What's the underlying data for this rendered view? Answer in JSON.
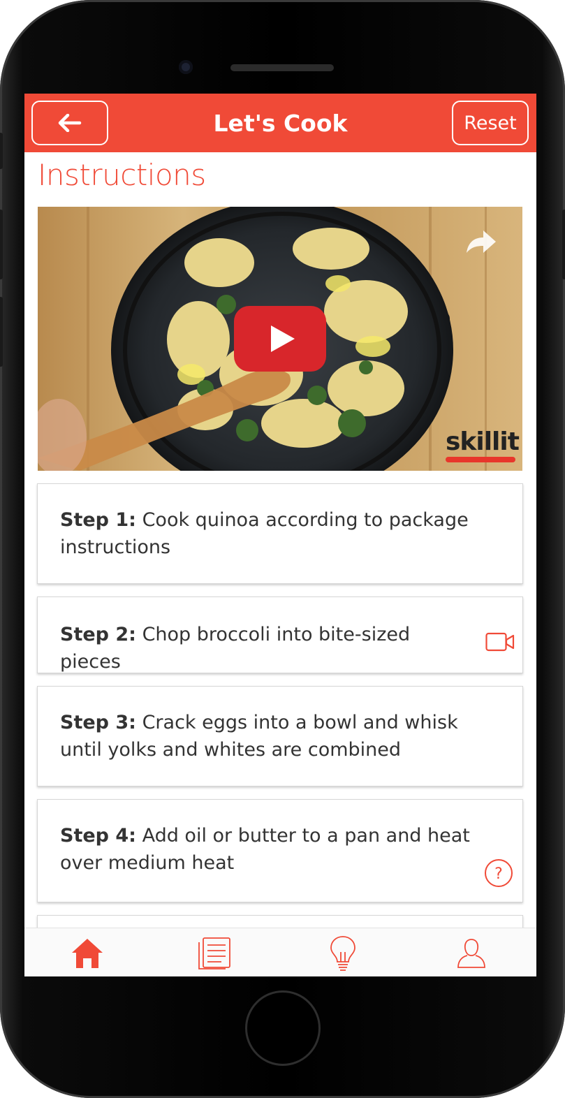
{
  "header": {
    "title": "Let's Cook",
    "back_icon": "arrow-left-icon",
    "reset_label": "Reset"
  },
  "section": {
    "title": "Instructions"
  },
  "video": {
    "brand": "skillit",
    "play_icon": "play-icon",
    "share_icon": "share-icon"
  },
  "steps": [
    {
      "label": "Step 1:",
      "text": "Cook quinoa according to package instructions",
      "icon": ""
    },
    {
      "label": "Step 2:",
      "text": "Chop broccoli into bite-sized pieces",
      "icon": "video-camera-icon"
    },
    {
      "label": "Step 3:",
      "text": "Crack eggs into a bowl and whisk until yolks and whites are combined",
      "icon": ""
    },
    {
      "label": "Step 4:",
      "text": "Add oil or butter to a pan and heat over medium heat",
      "icon": "help-icon"
    }
  ],
  "tabbar": {
    "items": [
      {
        "name": "home",
        "icon": "home-icon",
        "active": true
      },
      {
        "name": "recipes",
        "icon": "recipe-list-icon",
        "active": false
      },
      {
        "name": "tips",
        "icon": "lightbulb-icon",
        "active": false
      },
      {
        "name": "profile",
        "icon": "profile-icon",
        "active": false
      }
    ]
  },
  "colors": {
    "accent": "#f04a37",
    "play": "#d8262b",
    "text": "#333333"
  }
}
